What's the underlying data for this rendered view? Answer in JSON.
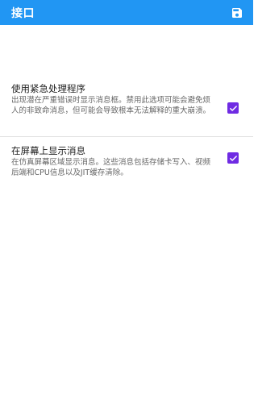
{
  "app_bar": {
    "title": "接口",
    "save_icon": "save-icon",
    "background": "#2196f3"
  },
  "settings": [
    {
      "title": "使用紧急处理程序",
      "description": "出现潜在严重错误时显示消息框。禁用此选项可能会避免烦人的非致命消息，但可能会导致根本无法解释的重大崩溃。",
      "checked": true
    },
    {
      "title": "在屏幕上显示消息",
      "description": "在仿真屏幕区域显示消息。这些消息包括存储卡写入、视频后端和CPU信息以及JIT缓存清除。",
      "checked": true
    }
  ],
  "colors": {
    "accent": "#6f2be3"
  }
}
